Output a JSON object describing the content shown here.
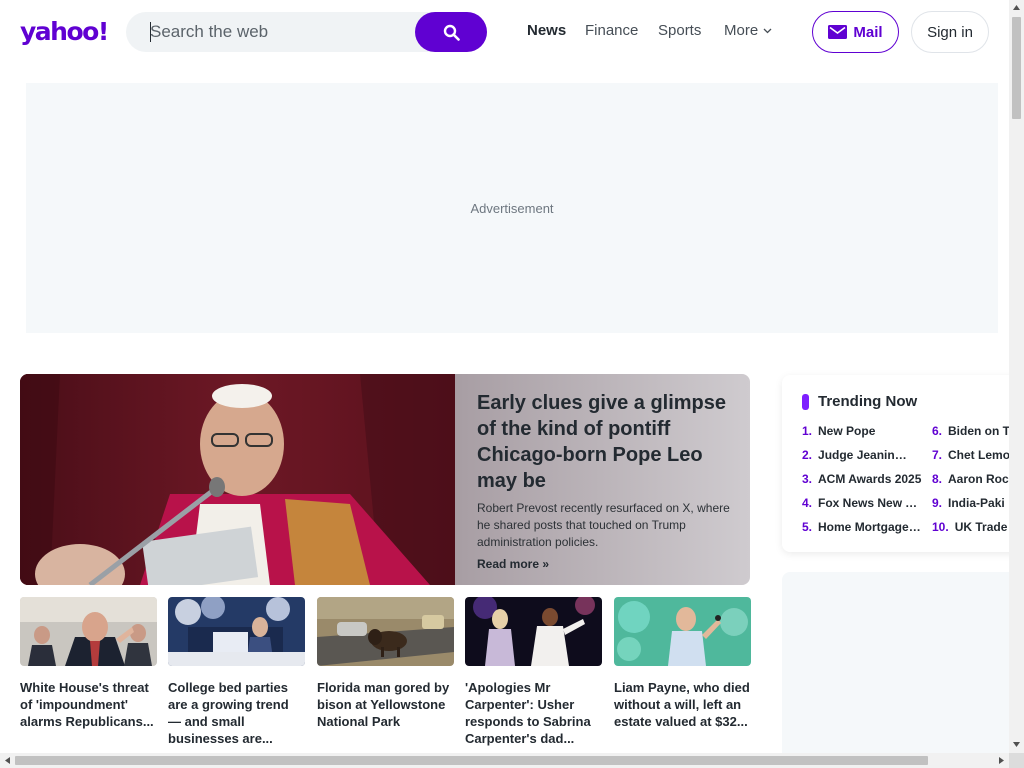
{
  "header": {
    "logo": "yahoo!",
    "search_placeholder": "Search the web",
    "nav": [
      "News",
      "Finance",
      "Sports",
      "More"
    ],
    "mail_label": "Mail",
    "signin_label": "Sign in"
  },
  "ad": {
    "label": "Advertisement"
  },
  "hero": {
    "title": "Early clues give a glimpse of the kind of pontiff Chicago-born Pope Leo may be",
    "description": "Robert Prevost recently resurfaced on X, where he shared posts that touched on Trump administration policies.",
    "read_more": "Read more »"
  },
  "cards": [
    {
      "title": "White House's threat of 'impoundment' alarms Republicans..."
    },
    {
      "title": "College bed parties are a growing trend — and small businesses are..."
    },
    {
      "title": "Florida man gored by bison at Yellowstone National Park"
    },
    {
      "title": "'Apologies Mr Carpenter': Usher responds to Sabrina Carpenter's dad..."
    },
    {
      "title": "Liam Payne, who died without a will, left an estate valued at $32..."
    }
  ],
  "trending": {
    "title": "Trending Now",
    "items": [
      {
        "num": "1.",
        "label": "New Pope"
      },
      {
        "num": "2.",
        "label": "Judge Jeanine Pirro"
      },
      {
        "num": "3.",
        "label": "ACM Awards 2025"
      },
      {
        "num": "4.",
        "label": "Fox News New York"
      },
      {
        "num": "5.",
        "label": "Home Mortgage Rates"
      },
      {
        "num": "6.",
        "label": "Biden on T"
      },
      {
        "num": "7.",
        "label": "Chet Lemo"
      },
      {
        "num": "8.",
        "label": "Aaron Roc"
      },
      {
        "num": "9.",
        "label": "India-Paki"
      },
      {
        "num": "10.",
        "label": "UK Trade"
      }
    ]
  },
  "colors": {
    "brand": "#6001d2",
    "accent": "#7e1fff"
  }
}
